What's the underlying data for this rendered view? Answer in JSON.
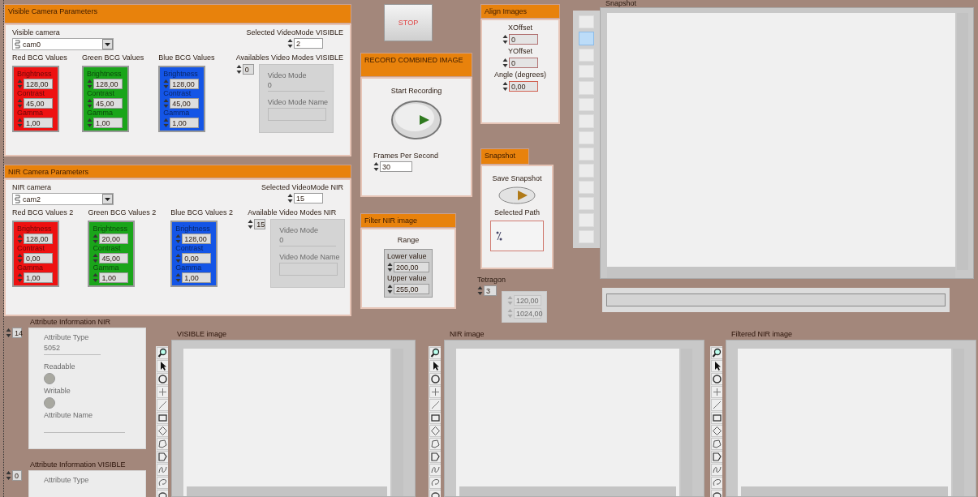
{
  "camera_panels": [
    {
      "title": "Visible Camera Parameters",
      "camera_label": "Visible camera",
      "camera": "cam0",
      "selected_mode_label": "Selected VideoMode VISIBLE",
      "selected_mode": "2",
      "bcg": [
        {
          "label": "Red BCG Values",
          "color": "#ee1111",
          "fields": [
            {
              "label": "Brightness",
              "value": "128,00"
            },
            {
              "label": "Contrast",
              "value": "45,00"
            },
            {
              "label": "Gamma",
              "value": "1,00"
            }
          ]
        },
        {
          "label": "Green BCG Values",
          "color": "#1aa51a",
          "fields": [
            {
              "label": "Brightness",
              "value": "128,00"
            },
            {
              "label": "Contrast",
              "value": "45,00"
            },
            {
              "label": "Gamma",
              "value": "1,00"
            }
          ]
        },
        {
          "label": "Blue BCG Values",
          "color": "#1455e6",
          "fields": [
            {
              "label": "Brightness",
              "value": "128,00"
            },
            {
              "label": "Contrast",
              "value": "45,00"
            },
            {
              "label": "Gamma",
              "value": "1,00"
            }
          ]
        }
      ],
      "modes": {
        "label": "Availables Video Modes VISIBLE",
        "index": "0",
        "disabled": true,
        "mode_label": "Video Mode",
        "mode": "0",
        "name_label": "Video Mode Name"
      }
    },
    {
      "title": "NIR Camera Parameters",
      "camera_label": "NIR camera",
      "camera": "cam2",
      "selected_mode_label": "Selected VideoMode NIR",
      "selected_mode": "15",
      "bcg": [
        {
          "label": "Red BCG Values 2",
          "color": "#ee1111",
          "fields": [
            {
              "label": "Brightness",
              "value": "128,00"
            },
            {
              "label": "Contrast",
              "value": "0,00"
            },
            {
              "label": "Gamma",
              "value": "1,00"
            }
          ]
        },
        {
          "label": "Green BCG Values 2",
          "color": "#1aa51a",
          "fields": [
            {
              "label": "Brightness",
              "value": "20,00"
            },
            {
              "label": "Contrast",
              "value": "45,00"
            },
            {
              "label": "Gamma",
              "value": "1,00"
            }
          ]
        },
        {
          "label": "Blue BCG Values 2",
          "color": "#1455e6",
          "fields": [
            {
              "label": "Brightness",
              "value": "128,00"
            },
            {
              "label": "Contrast",
              "value": "0,00"
            },
            {
              "label": "Gamma",
              "value": "1,00"
            }
          ]
        }
      ],
      "modes": {
        "label": "Available Video Modes NIR",
        "index": "15",
        "disabled": true,
        "mode_label": "Video Mode",
        "mode": "0",
        "name_label": "Video Mode Name"
      }
    }
  ],
  "stop_button": "STOP",
  "record": {
    "title": "RECORD COMBINED IMAGE",
    "button_label": "Start Recording",
    "fps_label": "Frames Per Second",
    "fps": "30"
  },
  "filter": {
    "title": "Filter NIR image",
    "range_label": "Range",
    "fields": [
      {
        "label": "Lower value",
        "value": "200,00"
      },
      {
        "label": "Upper value",
        "value": "255,00"
      }
    ]
  },
  "align": {
    "title": "Align Images",
    "fields": [
      {
        "label": "XOffset",
        "value": "0"
      },
      {
        "label": "YOffset",
        "value": "0"
      },
      {
        "label": "Angle (degrees)",
        "value": "0,00"
      }
    ]
  },
  "snapshot": {
    "title": "Snapshot",
    "button_label": "Save Snapshot",
    "path_label": "Selected Path"
  },
  "tetragon": {
    "label": "Tetragon",
    "index": "3",
    "disabled": true,
    "values": [
      "120,00",
      "1024,00"
    ]
  },
  "snapshot_display": {
    "label": "Snapshot",
    "thumbnails": [
      {
        "selected": false
      },
      {
        "selected": true
      },
      {
        "selected": false
      },
      {
        "selected": false
      },
      {
        "selected": false
      },
      {
        "selected": false
      },
      {
        "selected": false
      },
      {
        "selected": false
      },
      {
        "selected": false
      },
      {
        "selected": false
      },
      {
        "selected": false
      },
      {
        "selected": false
      },
      {
        "selected": false
      },
      {
        "selected": false
      }
    ]
  },
  "attributes": [
    {
      "label": "Attribute Information NIR",
      "index": "14",
      "disabled": true,
      "type_label": "Attribute Type",
      "type": "5052",
      "readable_label": "Readable",
      "writable_label": "Writable",
      "name_label": "Attribute Name"
    },
    {
      "label": "Attribute Information VISIBLE",
      "index": "0",
      "disabled": true,
      "type_label": "Attribute Type"
    }
  ],
  "image_displays": [
    {
      "label": "VISIBLE image"
    },
    {
      "label": "NIR image"
    },
    {
      "label": "Filtered NIR image"
    }
  ]
}
